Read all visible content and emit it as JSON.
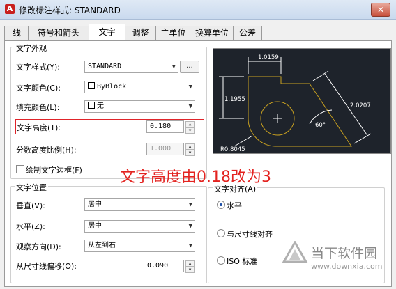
{
  "window": {
    "title": "修改标注样式: STANDARD",
    "close_label": "✕"
  },
  "tabs": [
    {
      "label": "线",
      "active": false
    },
    {
      "label": "符号和箭头",
      "active": false
    },
    {
      "label": "文字",
      "active": true
    },
    {
      "label": "调整",
      "active": false
    },
    {
      "label": "主单位",
      "active": false
    },
    {
      "label": "换算单位",
      "active": false
    },
    {
      "label": "公差",
      "active": false
    }
  ],
  "appearance": {
    "legend": "文字外观",
    "style_label": "文字样式(Y):",
    "style_value": "STANDARD",
    "style_button": "...",
    "color_label": "文字颜色(C):",
    "color_value": "ByBlock",
    "fill_label": "填充颜色(L):",
    "fill_value": "无",
    "height_label": "文字高度(T):",
    "height_value": "0.180",
    "fraction_label": "分数高度比例(H):",
    "fraction_value": "1.000",
    "frame_label": "绘制文字边框(F)"
  },
  "placement": {
    "legend": "文字位置",
    "vertical_label": "垂直(V):",
    "vertical_value": "居中",
    "horizontal_label": "水平(Z):",
    "horizontal_value": "居中",
    "view_label": "观察方向(D):",
    "view_value": "从左到右",
    "offset_label": "从尺寸线偏移(O):",
    "offset_value": "0.090"
  },
  "alignment": {
    "legend": "文字对齐(A)",
    "options": [
      {
        "label": "水平",
        "selected": true
      },
      {
        "label": "与尺寸线对齐",
        "selected": false
      },
      {
        "label": "ISO 标准",
        "selected": false
      }
    ]
  },
  "preview": {
    "dim_top": "1.0159",
    "dim_left": "1.1955",
    "dim_right": "2.0207",
    "angle": "60°",
    "radius": "R0.8045"
  },
  "annotation": "文字高度由0.18改为3",
  "watermark": {
    "brand": "当下软件园",
    "url": "www.downxia.com"
  },
  "colors": {
    "preview_bg": "#1e232b",
    "preview_line": "#c8a020",
    "annotation": "#e32320"
  }
}
